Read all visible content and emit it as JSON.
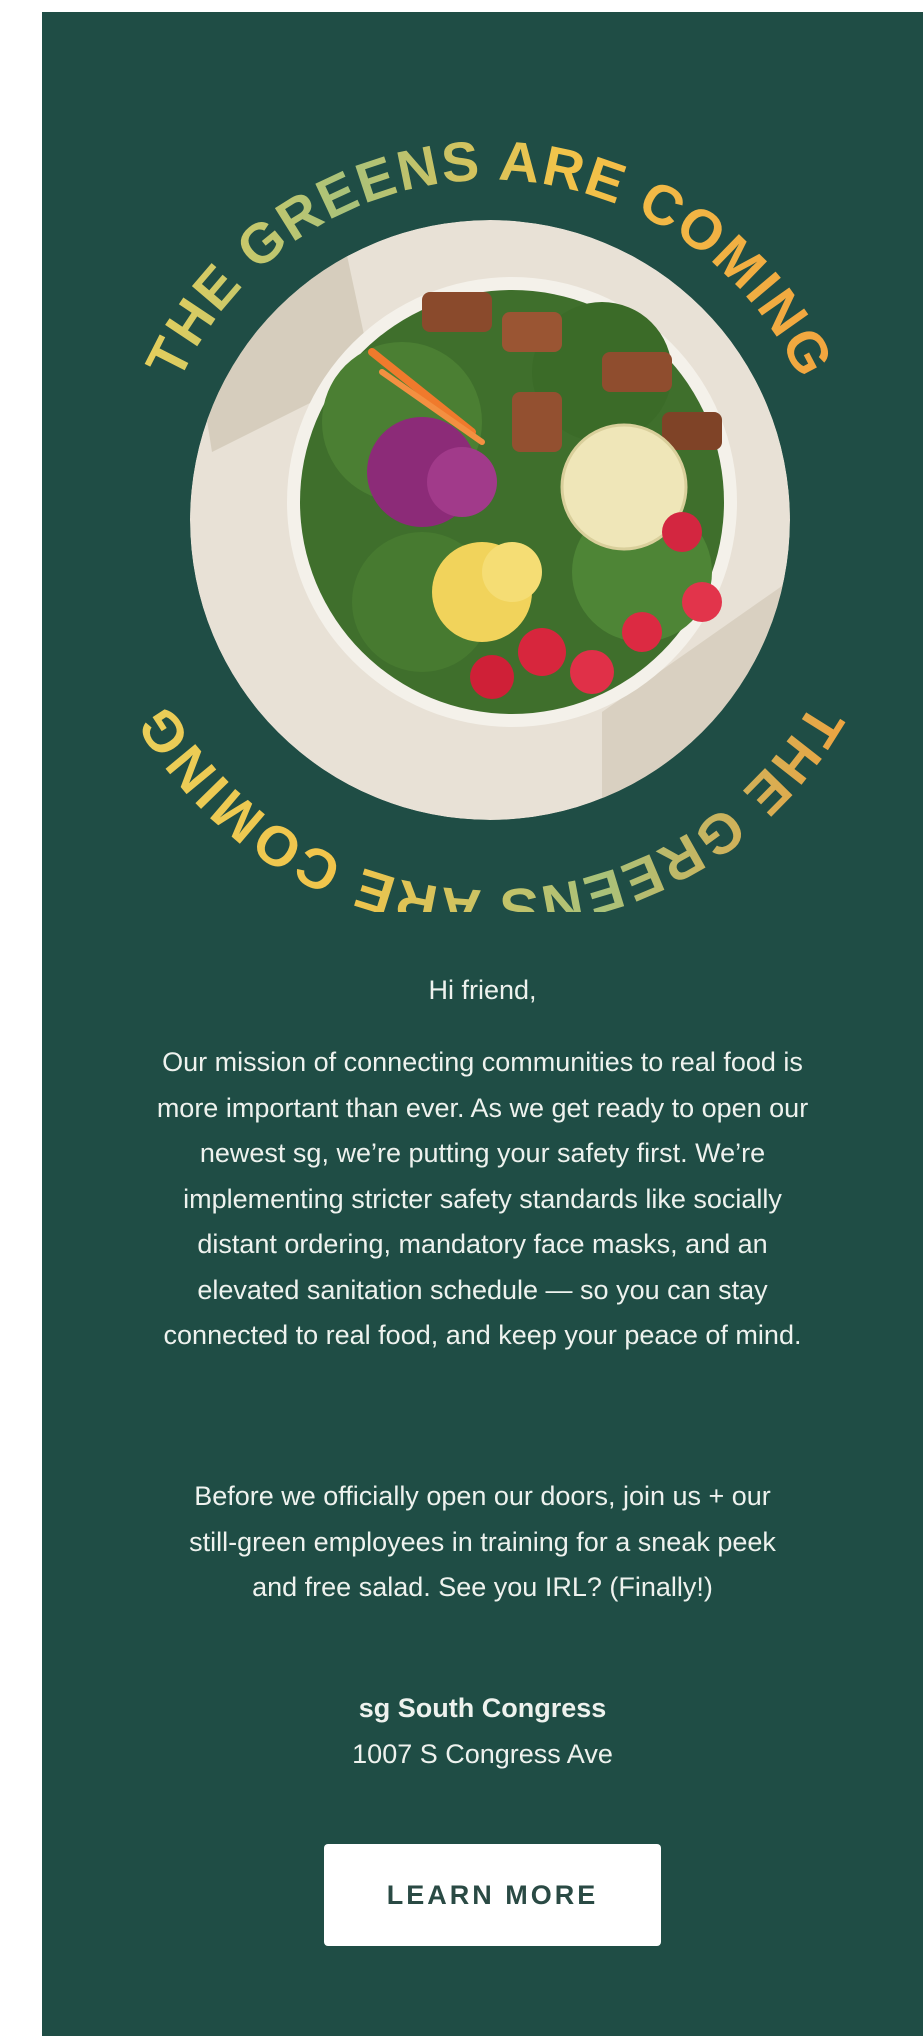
{
  "colors": {
    "panel_bg": "#1f4d45",
    "page_bg": "#ffffff",
    "text": "#eef2ee",
    "ring_green": "#a9c27a",
    "ring_yellow": "#f2c44a",
    "ring_orange": "#f1a33e",
    "cta_bg": "#ffffff",
    "cta_text": "#2a4a44"
  },
  "hero": {
    "ring_text_top": "THE GREENS ARE COMING",
    "ring_text_bottom": "THE GREENS ARE COMING",
    "image": "salad-bowl-photo"
  },
  "message": {
    "greeting": "Hi friend,",
    "paragraph_1": "Our mission of connecting communities to real food is more important than ever. As we get ready to open our newest sg, we’re putting your safety first. We’re implementing stricter safety standards like socially distant ordering, mandatory face masks, and an elevated sanitation schedule — so you can stay connected to real food, and keep your peace of mind.",
    "paragraph_2": "Before we officially open our doors, join us + our still-green employees in training for a sneak peek and free salad. See you IRL? (Finally!)"
  },
  "location": {
    "name": "sg South Congress",
    "address": "1007 S Congress Ave"
  },
  "cta": {
    "label": "LEARN MORE"
  }
}
